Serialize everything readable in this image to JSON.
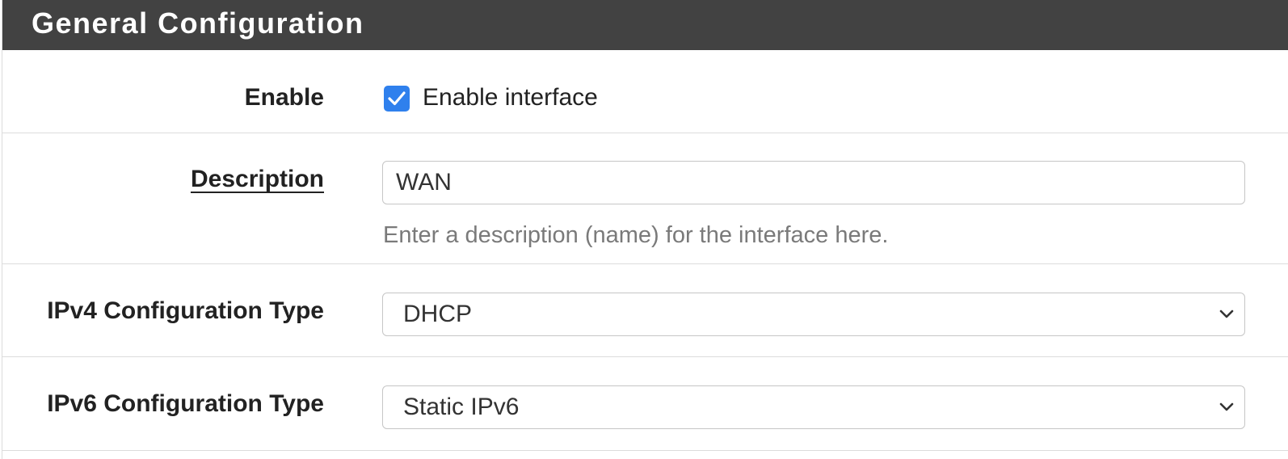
{
  "panel": {
    "title": "General Configuration"
  },
  "enable": {
    "label": "Enable",
    "checkbox_checked": true,
    "checkbox_label": "Enable interface"
  },
  "description": {
    "label": "Description",
    "value": "WAN",
    "help": "Enter a description (name) for the interface here."
  },
  "ipv4": {
    "label": "IPv4 Configuration Type",
    "selected": "DHCP"
  },
  "ipv6": {
    "label": "IPv6 Configuration Type",
    "selected": "Static IPv6"
  },
  "colors": {
    "header_bg": "#424242",
    "checkbox_accent": "#2f80ed",
    "border": "#dcdcdc",
    "help_text": "#7a7a7a"
  },
  "icons": {
    "checkbox": "checkmark-icon",
    "select_arrow": "chevron-down-icon"
  }
}
